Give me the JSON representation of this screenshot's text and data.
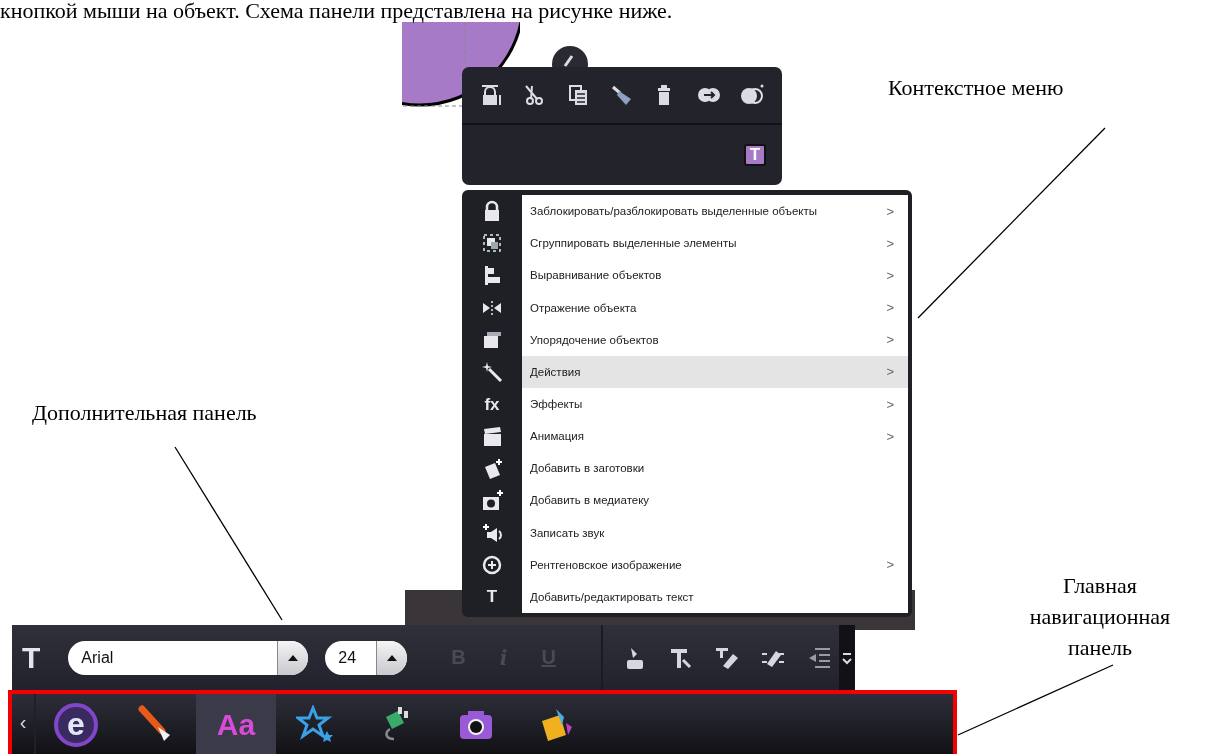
{
  "document_text": "кнопкой мыши на объект. Схема панели представлена на рисунке ниже.",
  "quick_toolbar": {
    "text_button": "T"
  },
  "context_menu": {
    "items": [
      {
        "label": "Заблокировать/разблокировать выделенные объекты",
        "submenu": true,
        "selected": false
      },
      {
        "label": "Сгруппировать выделенные элементы",
        "submenu": true,
        "selected": false
      },
      {
        "label": "Выравнивание объектов",
        "submenu": true,
        "selected": false
      },
      {
        "label": "Отражение объекта",
        "submenu": true,
        "selected": false
      },
      {
        "label": "Упорядочение объектов",
        "submenu": true,
        "selected": false
      },
      {
        "label": "Действия",
        "submenu": true,
        "selected": true
      },
      {
        "label": "Эффекты",
        "submenu": true,
        "selected": false,
        "glyph": "fx"
      },
      {
        "label": "Анимация",
        "submenu": true,
        "selected": false
      },
      {
        "label": "Добавить в заготовки",
        "submenu": false,
        "selected": false
      },
      {
        "label": "Добавить в медиатеку",
        "submenu": false,
        "selected": false
      },
      {
        "label": "Записать звук",
        "submenu": false,
        "selected": false
      },
      {
        "label": "Рентгеновское изображение",
        "submenu": true,
        "selected": false
      },
      {
        "label": "Добавить/редактировать текст",
        "submenu": false,
        "selected": false,
        "glyph": "T"
      }
    ],
    "arrow": ">"
  },
  "format_toolbar": {
    "text_icon": "T",
    "font": "Arial",
    "size": "24",
    "styles": [
      {
        "label": "B",
        "disabled": true
      },
      {
        "label": "i",
        "disabled": true
      },
      {
        "label": "U",
        "disabled": true
      }
    ]
  },
  "nav_bar": {
    "back": "‹",
    "items": [
      {
        "selected": false,
        "glyph": "e"
      },
      {
        "selected": false
      },
      {
        "selected": true,
        "glyph": "Aa"
      },
      {
        "selected": false
      },
      {
        "selected": false
      },
      {
        "selected": false
      },
      {
        "selected": false
      }
    ]
  },
  "callouts": [
    {
      "text": "Контекстное меню"
    },
    {
      "text": "Дополнительная панель"
    },
    {
      "text": "Главная навигационная панель"
    }
  ]
}
